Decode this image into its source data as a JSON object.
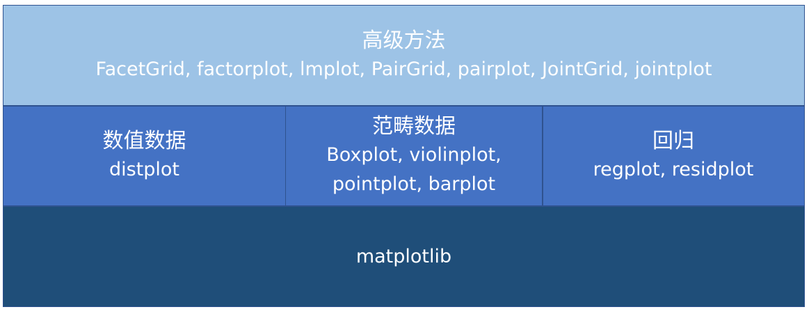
{
  "layers": {
    "top": {
      "title": "高级方法",
      "subtitle": "FacetGrid, factorplot, lmplot, PairGrid, pairplot, JointGrid, jointplot"
    },
    "middle": [
      {
        "title": "数值数据",
        "subtitle": "distplot"
      },
      {
        "title": "范畴数据",
        "subtitle": "Boxplot, violinplot, pointplot, barplot"
      },
      {
        "title": "回归",
        "subtitle": "regplot, residplot"
      }
    ],
    "bottom": {
      "title": "matplotlib"
    }
  },
  "colors": {
    "top_fill": "#9dc3e6",
    "middle_fill": "#4472c4",
    "bottom_fill": "#1f4e79",
    "border": "#2f528f",
    "text": "#ffffff"
  }
}
